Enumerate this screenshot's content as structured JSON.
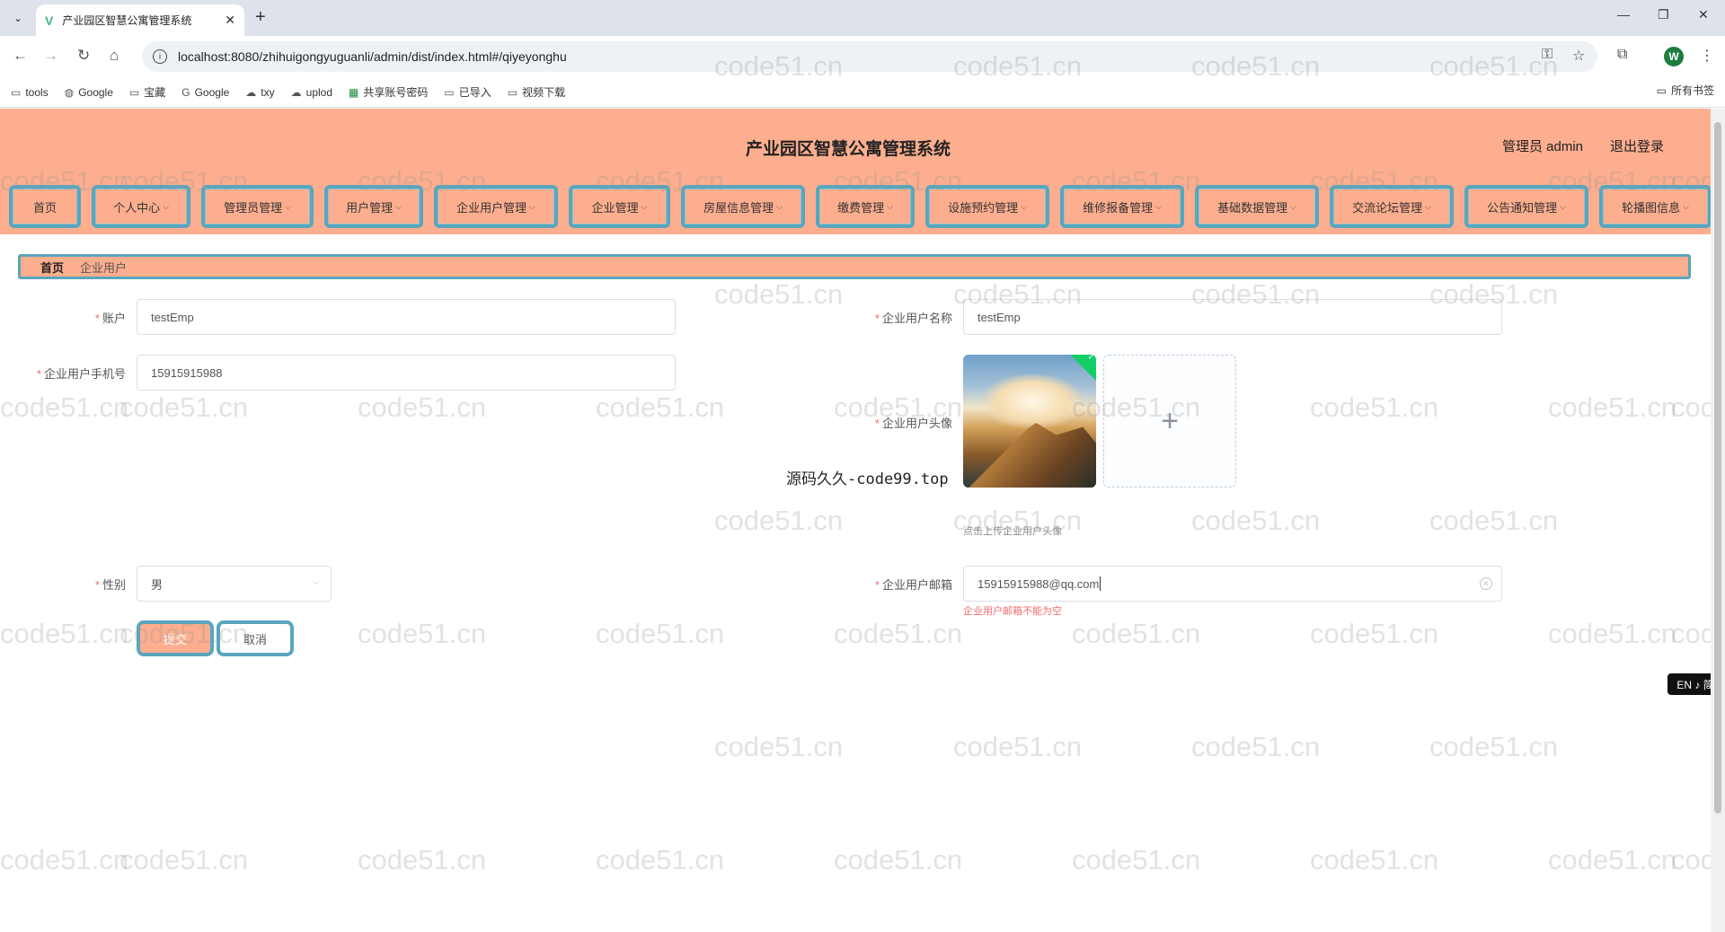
{
  "browser": {
    "tab_title": "产业园区智慧公寓管理系统",
    "url": "localhost:8080/zhihuigongyuguanli/admin/dist/index.html#/qiyeyonghu",
    "bookmarks": [
      "tools",
      "Google",
      "宝藏",
      "Google",
      "txy",
      "uplod",
      "共享账号密码",
      "已导入",
      "视频下载"
    ],
    "bookmarks_right": "所有书签",
    "profile_initial": "W"
  },
  "header": {
    "title": "产业园区智慧公寓管理系统",
    "user": "管理员 admin",
    "logout": "退出登录"
  },
  "menu": [
    {
      "label": "首页",
      "dropdown": false
    },
    {
      "label": "个人中心",
      "dropdown": true
    },
    {
      "label": "管理员管理",
      "dropdown": true
    },
    {
      "label": "用户管理",
      "dropdown": true
    },
    {
      "label": "企业用户管理",
      "dropdown": true
    },
    {
      "label": "企业管理",
      "dropdown": true
    },
    {
      "label": "房屋信息管理",
      "dropdown": true
    },
    {
      "label": "缴费管理",
      "dropdown": true
    },
    {
      "label": "设施预约管理",
      "dropdown": true
    },
    {
      "label": "维修报备管理",
      "dropdown": true
    },
    {
      "label": "基础数据管理",
      "dropdown": true
    },
    {
      "label": "交流论坛管理",
      "dropdown": true
    },
    {
      "label": "公告通知管理",
      "dropdown": true
    },
    {
      "label": "轮播图信息",
      "dropdown": true
    }
  ],
  "breadcrumb": {
    "home": "首页",
    "current": "企业用户"
  },
  "form": {
    "account_label": "账户",
    "account_value": "testEmp",
    "name_label": "企业用户名称",
    "name_value": "testEmp",
    "phone_label": "企业用户手机号",
    "phone_value": "15915915988",
    "avatar_label": "企业用户头像",
    "avatar_tip": "点击上传企业用户头像",
    "upload_plus": "+",
    "gender_label": "性别",
    "gender_value": "男",
    "email_label": "企业用户邮箱",
    "email_value": "15915915988@qq.com",
    "email_error": "企业用户邮箱不能为空",
    "submit": "提交",
    "cancel": "取消"
  },
  "overlay": {
    "source_note": "源码久久-code99.top",
    "watermark": "code51.cn",
    "ime": "EN ♪ 简"
  },
  "colors": {
    "header_bg": "#fdae8e",
    "menu_border": "#59a6bd",
    "required": "#f56c6c"
  }
}
